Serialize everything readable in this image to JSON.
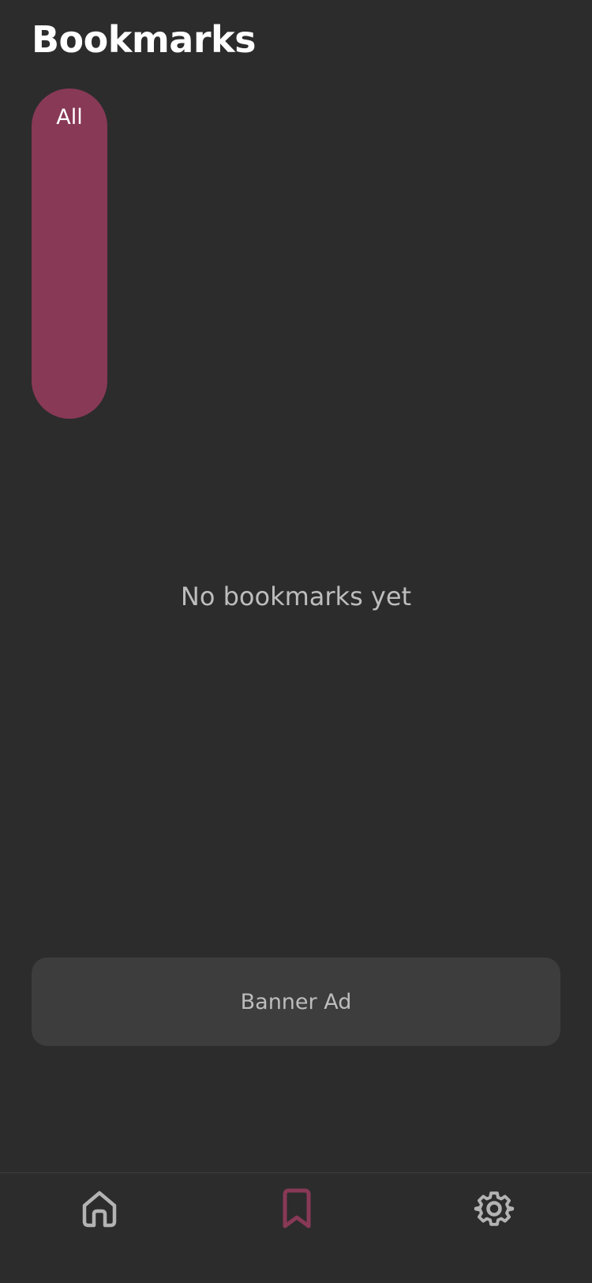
{
  "header": {
    "title": "Bookmarks"
  },
  "filters": {
    "items": [
      {
        "label": "All",
        "selected": true
      }
    ]
  },
  "empty_state": {
    "message": "No bookmarks yet"
  },
  "banner": {
    "label": "Banner Ad"
  },
  "bottom_nav": {
    "items": [
      {
        "icon": "home-icon",
        "selected": false
      },
      {
        "icon": "bookmark-icon",
        "selected": true
      },
      {
        "icon": "gear-icon",
        "selected": false
      }
    ]
  },
  "colors": {
    "background": "#2c2c2c",
    "accent": "#883956",
    "muted_text": "#bdbdbd",
    "inactive_icon": "#b3b3b3",
    "banner_background": "#3d3d3d"
  }
}
